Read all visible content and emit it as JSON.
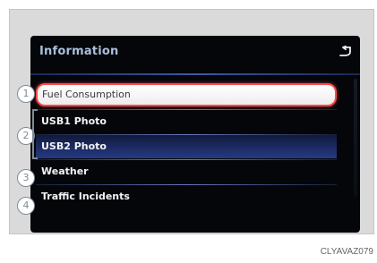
{
  "header": {
    "title": "Information",
    "back_icon": "back-arrow-icon"
  },
  "menu": {
    "items": [
      {
        "label": "Fuel Consumption",
        "state": "selected"
      },
      {
        "label": "USB1 Photo"
      },
      {
        "label": "USB2 Photo",
        "state": "highlighted"
      },
      {
        "label": "Weather"
      },
      {
        "label": "Traffic Incidents"
      }
    ]
  },
  "callouts": {
    "one": "1",
    "two": "2",
    "three": "3",
    "four": "4"
  },
  "caption": "CLYAVAZ079",
  "colors": {
    "screen_bg": "#05060a",
    "title": "#a9bfdc",
    "selection_border": "#ff4a4a",
    "highlight": "#263a84"
  }
}
